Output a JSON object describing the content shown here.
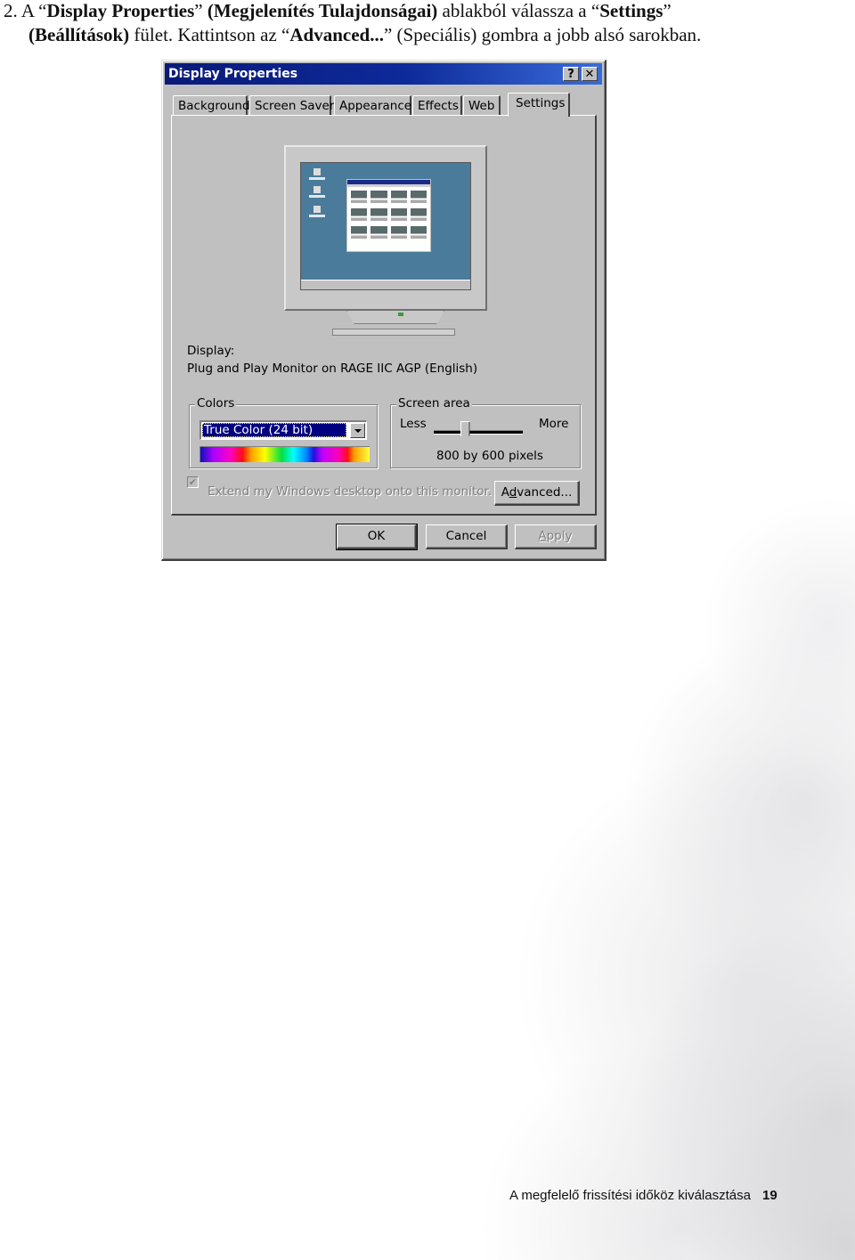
{
  "instruction": {
    "number": "2.",
    "segments_line1": [
      {
        "text": "A “",
        "bold": false
      },
      {
        "text": "Display Properties",
        "bold": true
      },
      {
        "text": "” ",
        "bold": false
      },
      {
        "text": "(Megjelenítés Tulajdonságai)",
        "bold": true
      },
      {
        "text": " ablakból válassza a “",
        "bold": false
      },
      {
        "text": "Settings",
        "bold": true
      },
      {
        "text": "”",
        "bold": false
      }
    ],
    "segments_line2": [
      {
        "text": "(Beállítások)",
        "bold": true
      },
      {
        "text": " fület. Kattintson az “",
        "bold": false
      },
      {
        "text": "Advanced...",
        "bold": true
      },
      {
        "text": "” (Speciális) gombra a jobb alsó sarokban.",
        "bold": false
      }
    ]
  },
  "dialog": {
    "title": "Display Properties",
    "help_button": "?",
    "close_button": "✕",
    "tabs": [
      {
        "label": "Background",
        "active": false
      },
      {
        "label": "Screen Saver",
        "active": false
      },
      {
        "label": "Appearance",
        "active": false
      },
      {
        "label": "Effects",
        "active": false
      },
      {
        "label": "Web",
        "active": false
      },
      {
        "label": "Settings",
        "active": true
      }
    ],
    "display_label": "Display:",
    "display_value": "Plug and Play Monitor on RAGE IIC AGP (English)",
    "colors": {
      "legend": "Colors",
      "selected": "True Color (24 bit)"
    },
    "screen_area": {
      "legend": "Screen area",
      "less_label": "Less",
      "more_label": "More",
      "slider_fraction": 0.35,
      "value_text": "800 by 600 pixels"
    },
    "extend_checkbox": {
      "label": "Extend my Windows desktop onto this monitor.",
      "checked": true,
      "disabled": true
    },
    "advanced_button": {
      "prefix": "A",
      "underlined": "d",
      "suffix": "vanced..."
    },
    "ok_button": "OK",
    "cancel_button": "Cancel",
    "apply_button": {
      "underlined": "A",
      "suffix": "pply",
      "disabled": true
    },
    "colors_palette": {
      "title_start": "#0a1a78",
      "title_end": "#3a6cd8",
      "face": "#c0c0c0",
      "selection": "#000080",
      "preview_desktop": "#4a7b9a"
    }
  },
  "footer": {
    "title": "A megfelelő frissítési időköz kiválasztása",
    "page_number": "19"
  }
}
